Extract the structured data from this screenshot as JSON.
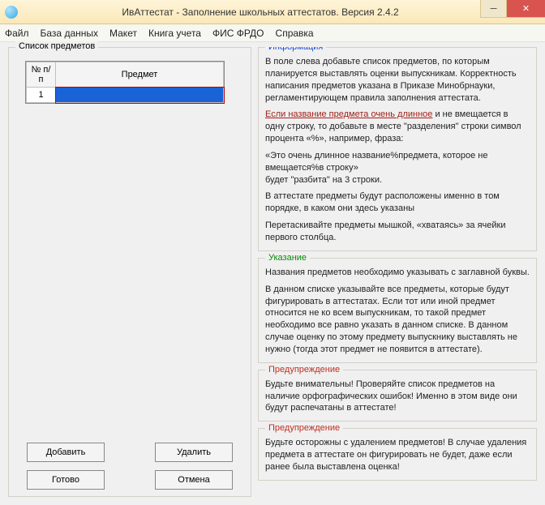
{
  "window": {
    "title": "ИвАттестат - Заполнение школьных аттестатов. Версия 2.4.2"
  },
  "menu": {
    "file": "Файл",
    "db": "База данных",
    "layout": "Макет",
    "book": "Книга учета",
    "fis": "ФИС ФРДО",
    "help": "Справка"
  },
  "left": {
    "group_title": "Список предметов",
    "col_num": "№ п/п",
    "col_subject": "Предмет",
    "row1_num": "1",
    "row1_subject": "",
    "btn_add": "Добавить",
    "btn_delete": "Удалить",
    "btn_ready": "Готово",
    "btn_cancel": "Отмена"
  },
  "info": {
    "legend": "Информация",
    "p1": "В поле слева добавьте список предметов, по которым планируется выставлять оценки выпускникам. Корректность написания предметов указана в Приказе Минобрнауки, регламентирующем правила заполнения аттестата.",
    "p2a": "Если название предмета очень длинное",
    "p2b": " и не вмещается в одну строку, то добавьте в месте \"разделения\" строки символ процента «%», например, фраза:",
    "p3": "«Это очень длинное название%предмета, которое не вмещается%в строку»",
    "p4": "будет \"разбита\" на 3 строки.",
    "p5": "В аттестате предметы будут расположены именно в том порядке, в каком они здесь указаны",
    "p6": "Перетаскивайте предметы мышкой, «хватаясь» за ячейки первого столбца."
  },
  "hint": {
    "legend": "Указание",
    "p1": "Названия предметов необходимо указывать с заглавной буквы.",
    "p2": "В данном списке указывайте все предметы, которые будут фигурировать в аттестатах. Если тот или иной предмет относится не ко всем выпускникам, то такой предмет необходимо все равно указать в данном списке. В данном случае оценку по этому предмету выпускнику выставлять не нужно (тогда этот предмет не появится в аттестате)."
  },
  "warn1": {
    "legend": "Предупреждение",
    "p1": "Будьте внимательны! Проверяйте список предметов на наличие орфографических ошибок! Именно в этом виде они будут распечатаны в аттестате!"
  },
  "warn2": {
    "legend": "Предупреждение",
    "p1": "Будьте осторожны с удалением предметов! В случае удаления предмета в аттестате он фигурировать не будет, даже если ранее была выставлена оценка!"
  }
}
